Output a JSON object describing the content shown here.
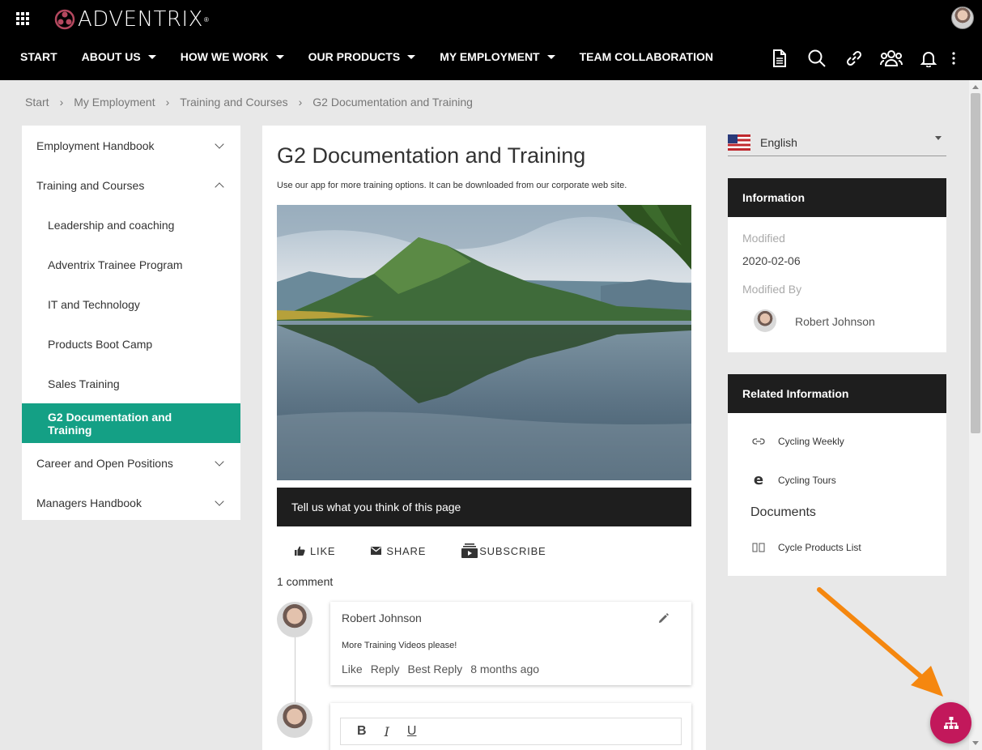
{
  "brand": {
    "name": "ADVENTRIX",
    "reg": "®"
  },
  "nav": [
    {
      "label": "START",
      "dropdown": false
    },
    {
      "label": "ABOUT US",
      "dropdown": true
    },
    {
      "label": "HOW WE WORK",
      "dropdown": true
    },
    {
      "label": "OUR PRODUCTS",
      "dropdown": true
    },
    {
      "label": "MY EMPLOYMENT",
      "dropdown": true
    },
    {
      "label": "TEAM COLLABORATION",
      "dropdown": false
    }
  ],
  "nav_icons": [
    "document-icon",
    "search-icon",
    "link-icon",
    "people-icon",
    "bell-icon",
    "more-vert-icon"
  ],
  "breadcrumb": [
    "Start",
    "My Employment",
    "Training and Courses",
    "G2 Documentation and Training"
  ],
  "breadcrumb_sep": "›",
  "leftnav": {
    "items": [
      {
        "label": "Employment Handbook",
        "chevron": "down"
      },
      {
        "label": "Training and Courses",
        "chevron": "up"
      },
      {
        "label": "Leadership and coaching"
      },
      {
        "label": "Adventrix Trainee Program"
      },
      {
        "label": "IT and Technology"
      },
      {
        "label": "Products Boot Camp"
      },
      {
        "label": "Sales Training"
      },
      {
        "label": "G2 Documentation and Training"
      },
      {
        "label": "Career and Open Positions",
        "chevron": "down"
      },
      {
        "label": "Managers Handbook",
        "chevron": "down"
      }
    ]
  },
  "main": {
    "title": "G2 Documentation and Training",
    "intro": "Use our app for more training options. It can be downloaded from our corporate web site.",
    "feedback": "Tell us what you think of this page",
    "actions": {
      "like": "LIKE",
      "share": "SHARE",
      "subscribe": "SUBSCRIBE"
    },
    "comment_count": "1 comment",
    "comment": {
      "author": "Robert Johnson",
      "text": "More Training Videos please!",
      "links": [
        "Like",
        "Reply",
        "Best Reply",
        "8 months ago"
      ]
    },
    "editor": {
      "bold": "B",
      "italic": "I",
      "underline": "U"
    }
  },
  "language": {
    "selected": "English"
  },
  "info": {
    "head": "Information",
    "modified_label": "Modified",
    "modified_value": "2020-02-06",
    "modified_by_label": "Modified By",
    "modified_by": "Robert Johnson"
  },
  "related": {
    "head": "Related Information",
    "links": [
      "Cycling Weekly",
      "Cycling Tours"
    ],
    "documents_head": "Documents",
    "documents": [
      "Cycle Products List"
    ]
  },
  "colors": {
    "accent": "#14a085",
    "fab": "#c2185b",
    "arrow": "#f5870f",
    "header": "#000000"
  }
}
